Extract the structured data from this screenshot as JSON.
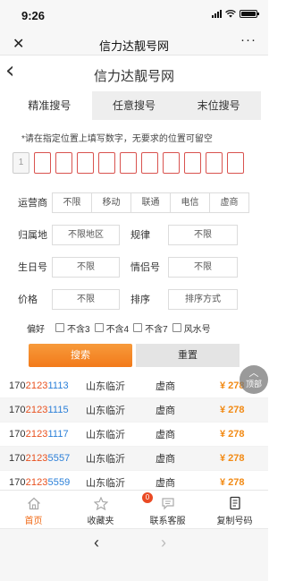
{
  "status": {
    "time": "9:26"
  },
  "navbar": {
    "title": "信力达靓号网",
    "close_icon": "close-icon",
    "more_icon": "more-icon"
  },
  "page": {
    "title": "信力达靓号网"
  },
  "tabs": [
    "精准搜号",
    "任意搜号",
    "末位搜号"
  ],
  "hint": "*请在指定位置上填写数字，无要求的位置可留空",
  "digits": {
    "first": "1",
    "empty_count_shown": 10
  },
  "filters": {
    "carrier_label": "运营商",
    "carrier_options": [
      "不限",
      "移动",
      "联通",
      "电信",
      "虚商"
    ],
    "location_label": "归属地",
    "location_value": "不限地区",
    "rule_label": "规律",
    "rule_value": "不限",
    "birthday_label": "生日号",
    "birthday_value": "不限",
    "couple_label": "情侣号",
    "couple_value": "不限",
    "price_label": "价格",
    "price_value": "不限",
    "sort_label": "排序",
    "sort_value": "排序方式"
  },
  "prefs": {
    "label": "偏好",
    "options": [
      "不含3",
      "不含4",
      "不含7",
      "风水号"
    ]
  },
  "buttons": {
    "search": "搜索",
    "reset": "重置"
  },
  "results": [
    {
      "p1": "170",
      "p2": "2123",
      "p3": "1113",
      "city": "山东临沂",
      "carrier": "虚商",
      "price": "¥ 278"
    },
    {
      "p1": "170",
      "p2": "2123",
      "p3": "1115",
      "city": "山东临沂",
      "carrier": "虚商",
      "price": "¥ 278"
    },
    {
      "p1": "170",
      "p2": "2123",
      "p3": "1117",
      "city": "山东临沂",
      "carrier": "虚商",
      "price": "¥ 278"
    },
    {
      "p1": "170",
      "p2": "2123",
      "p3": "5557",
      "city": "山东临沂",
      "carrier": "虚商",
      "price": "¥ 278"
    },
    {
      "p1": "170",
      "p2": "2123",
      "p3": "5559",
      "city": "山东临沂",
      "carrier": "虚商",
      "price": "¥ 278"
    }
  ],
  "to_top": "顶部",
  "bottom_nav": {
    "home": "首页",
    "favorites": "收藏夹",
    "favorites_badge": "0",
    "service": "联系客服",
    "copy": "复制号码"
  },
  "colors": {
    "accent": "#f06a16",
    "digit_border": "#d9534f",
    "num_highlight": "#e8501e",
    "num_tail": "#2a7fd8",
    "price": "#f28a14"
  }
}
